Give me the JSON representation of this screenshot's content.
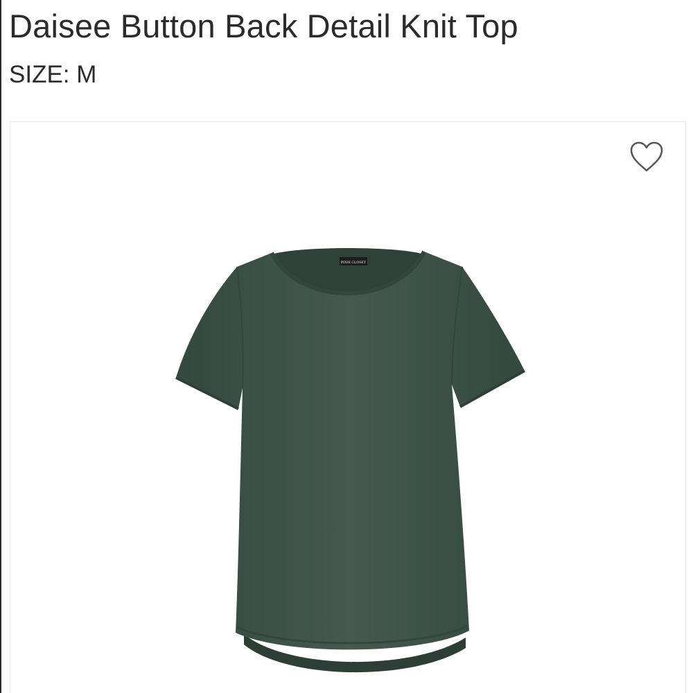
{
  "product": {
    "title": "Daisee Button Back Detail Knit Top",
    "size_label": "SIZE:",
    "size_value": "M",
    "label_text": "PIXIE CLOSET",
    "color": "#3e5449"
  },
  "icons": {
    "favorite": "heart-outline-icon"
  },
  "colors": {
    "text": "#2b2b2b",
    "garment": "#3e5449",
    "border": "#e6e6e6"
  }
}
